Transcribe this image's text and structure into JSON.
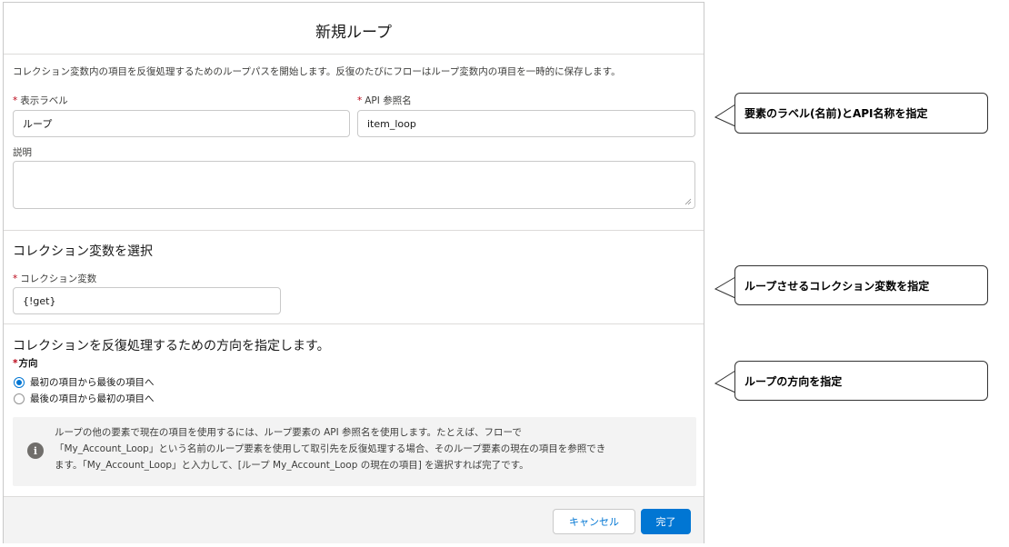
{
  "dialog": {
    "title": "新規ループ",
    "description": "コレクション変数内の項目を反復処理するためのループパスを開始します。反復のたびにフローはループ変数内の項目を一時的に保存します。",
    "required_marker": "*",
    "label_field": {
      "label": "表示ラベル",
      "value": "ループ"
    },
    "api_field": {
      "label": "API 参照名",
      "value": "item_loop"
    },
    "description_field": {
      "label": "説明",
      "value": ""
    }
  },
  "collection_section": {
    "title": "コレクション変数を選択",
    "field_label": "コレクション変数",
    "value": "{!get}"
  },
  "direction_section": {
    "title": "コレクションを反復処理するための方向を指定します。",
    "field_label": "方向",
    "options": [
      {
        "label": "最初の項目から最後の項目へ",
        "selected": true
      },
      {
        "label": "最後の項目から最初の項目へ",
        "selected": false
      }
    ]
  },
  "info": {
    "icon": "info-icon",
    "icon_glyph": "i",
    "line1": "ループの他の要素で現在の項目を使用するには、ループ要素の API 参照名を使用します。たとえば、フローで",
    "line2": "「My_Account_Loop」という名前のループ要素を使用して取引先を反復処理する場合、そのループ要素の現在の項目を参照でき",
    "line3": "ます。「My_Account_Loop」と入力して、[ループ My_Account_Loop の現在の項目] を選択すれば完了です。"
  },
  "footer": {
    "cancel_label": "キャンセル",
    "done_label": "完了"
  },
  "callouts": [
    "要素のラベル(名前)とAPI名称を指定",
    "ループさせるコレクション変数を指定",
    "ループの方向を指定"
  ],
  "colors": {
    "brand": "#0176d3",
    "required": "#ba0517",
    "border": "#c9c9c9",
    "info_background": "#f3f3f3"
  }
}
